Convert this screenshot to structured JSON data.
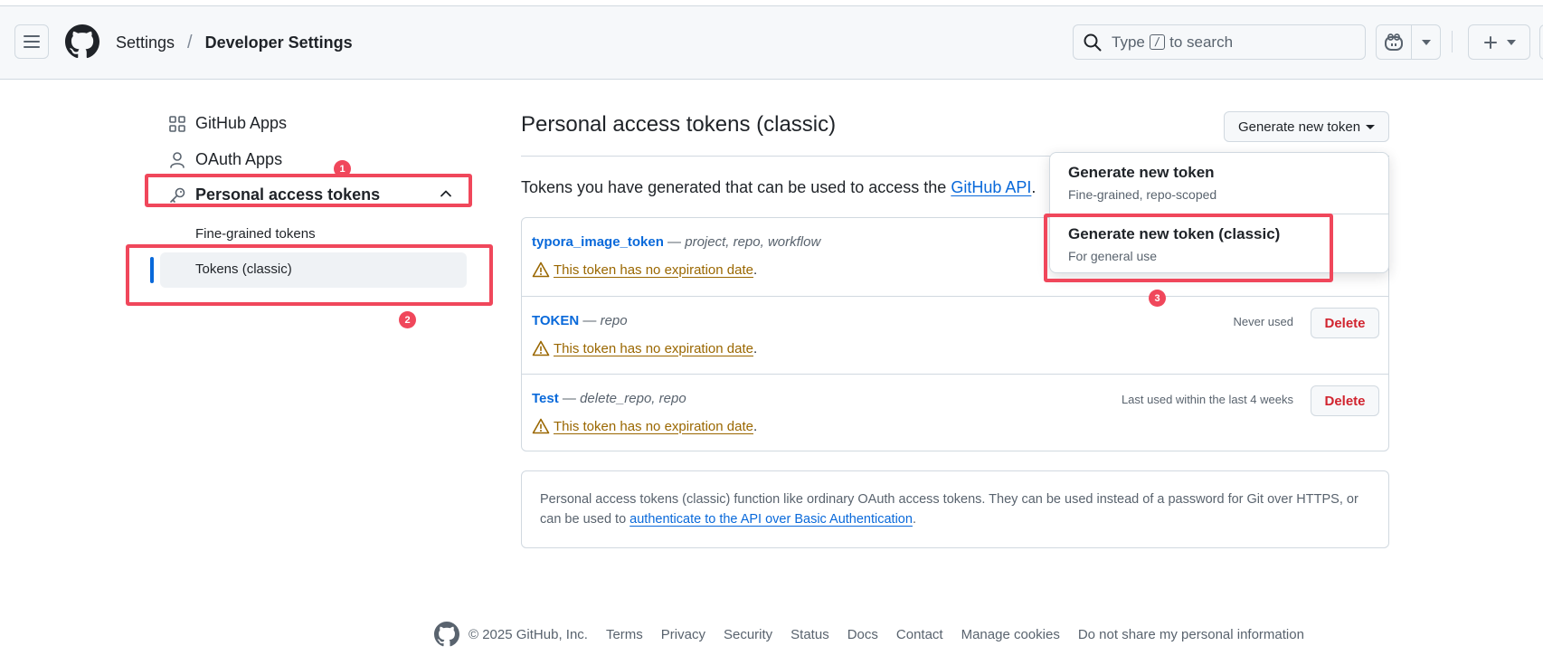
{
  "header": {
    "breadcrumb_settings": "Settings",
    "breadcrumb_separator": "/",
    "breadcrumb_current": "Developer Settings",
    "search_prefix": "Type",
    "search_key": "/",
    "search_suffix": "to search"
  },
  "sidebar": {
    "github_apps": "GitHub Apps",
    "oauth_apps": "OAuth Apps",
    "personal_access_tokens": "Personal access tokens",
    "fine_grained": "Fine-grained tokens",
    "tokens_classic": "Tokens (classic)"
  },
  "main": {
    "title": "Personal access tokens (classic)",
    "generate_button": "Generate new token",
    "intro_text": "Tokens you have generated that can be used to access the ",
    "intro_link": "GitHub API",
    "intro_end": ".",
    "tokens": [
      {
        "name": "typora_image_token",
        "dash": " — ",
        "scopes": "project, repo, workflow",
        "warning": "This token has no expiration date",
        "used": "",
        "delete": ""
      },
      {
        "name": "TOKEN",
        "dash": " — ",
        "scopes": "repo",
        "warning": "This token has no expiration date",
        "used": "Never used",
        "delete": "Delete"
      },
      {
        "name": "Test",
        "dash": " — ",
        "scopes": "delete_repo, repo",
        "warning": "This token has no expiration date",
        "used": "Last used within the last 4 weeks",
        "delete": "Delete"
      }
    ],
    "info_text": "Personal access tokens (classic) function like ordinary OAuth access tokens. They can be used instead of a password for Git over HTTPS, or can be used to ",
    "info_link": "authenticate to the API over Basic Authentication",
    "info_end": "."
  },
  "dropdown": {
    "item1_title": "Generate new token",
    "item1_sub": "Fine-grained, repo-scoped",
    "item2_title": "Generate new token (classic)",
    "item2_sub": "For general use"
  },
  "annotations": [
    "1",
    "2",
    "3"
  ],
  "footer": {
    "copyright": "© 2025 GitHub, Inc.",
    "links": [
      "Terms",
      "Privacy",
      "Security",
      "Status",
      "Docs",
      "Contact",
      "Manage cookies",
      "Do not share my personal information"
    ]
  },
  "colors": {
    "accent": "#0969da",
    "annotation": "#f0475b",
    "warning": "#9a6700",
    "danger": "#d1242f"
  },
  "icons": {
    "hamburger": "hamburger-icon",
    "logo": "github-logo-icon",
    "search": "search-icon",
    "copilot": "copilot-icon",
    "plus": "plus-icon",
    "apps": "apps-grid-icon",
    "person": "person-icon",
    "key": "key-icon",
    "chevron": "chevron-up-icon",
    "alert": "alert-icon"
  }
}
